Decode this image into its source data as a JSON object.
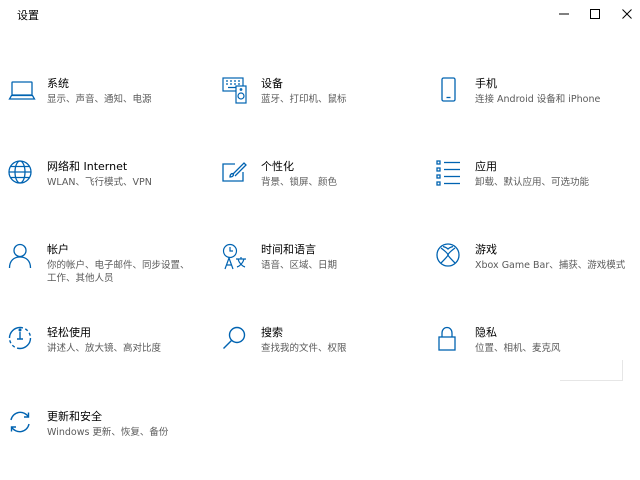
{
  "window": {
    "title": "设置",
    "accent": "#0063b1"
  },
  "tiles": [
    {
      "title": "系统",
      "desc": "显示、声音、通知、电源",
      "icon": "laptop-icon"
    },
    {
      "title": "设备",
      "desc": "蓝牙、打印机、鼠标",
      "icon": "keyboard-icon"
    },
    {
      "title": "手机",
      "desc": "连接 Android 设备和 iPhone",
      "icon": "phone-icon"
    },
    {
      "title": "网络和 Internet",
      "desc": "WLAN、飞行模式、VPN",
      "icon": "globe-icon"
    },
    {
      "title": "个性化",
      "desc": "背景、锁屏、颜色",
      "icon": "paint-brush-icon"
    },
    {
      "title": "应用",
      "desc": "卸载、默认应用、可选功能",
      "icon": "apps-list-icon"
    },
    {
      "title": "帐户",
      "desc": "你的帐户、电子邮件、同步设置、工作、其他人员",
      "icon": "person-icon"
    },
    {
      "title": "时间和语言",
      "desc": "语音、区域、日期",
      "icon": "time-language-icon"
    },
    {
      "title": "游戏",
      "desc": "Xbox Game Bar、捕获、游戏模式",
      "icon": "xbox-icon"
    },
    {
      "title": "轻松使用",
      "desc": "讲述人、放大镜、高对比度",
      "icon": "ease-of-access-icon"
    },
    {
      "title": "搜索",
      "desc": "查找我的文件、权限",
      "icon": "search-icon"
    },
    {
      "title": "隐私",
      "desc": "位置、相机、麦克风",
      "icon": "lock-icon"
    },
    {
      "title": "更新和安全",
      "desc": "Windows 更新、恢复、备份",
      "icon": "sync-icon"
    }
  ]
}
